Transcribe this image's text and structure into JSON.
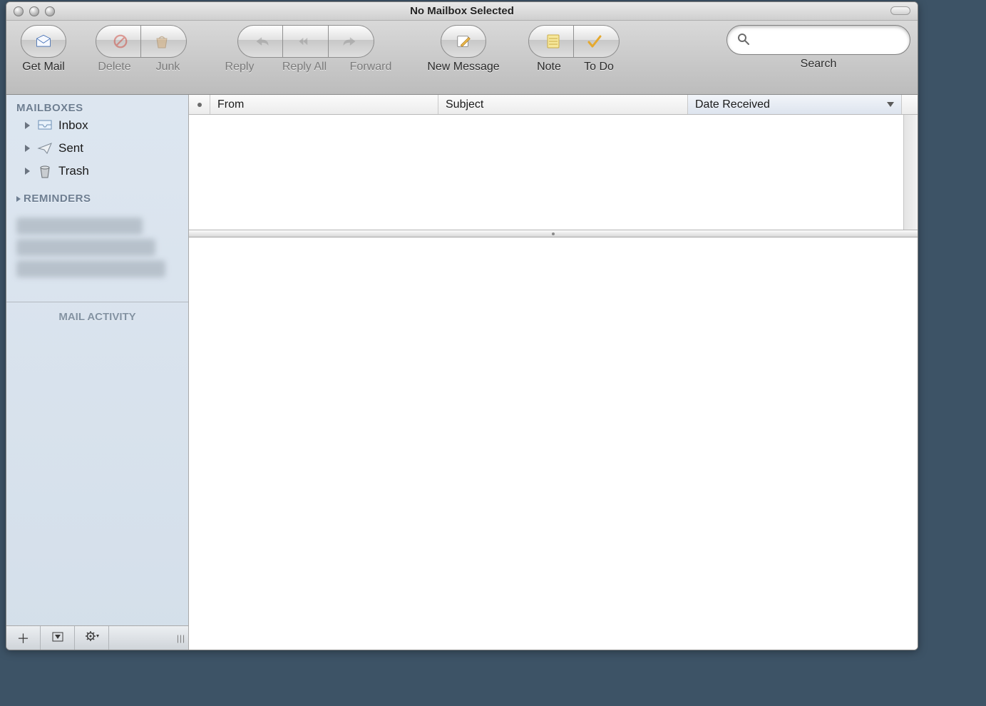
{
  "window": {
    "title": "No Mailbox Selected"
  },
  "toolbar": {
    "getmail": "Get Mail",
    "delete": "Delete",
    "junk": "Junk",
    "reply": "Reply",
    "replyall": "Reply All",
    "forward": "Forward",
    "newmessage": "New Message",
    "note": "Note",
    "todo": "To Do",
    "search_label": "Search",
    "search_placeholder": ""
  },
  "sidebar": {
    "sections": {
      "mailboxes": "MAILBOXES",
      "reminders": "REMINDERS",
      "activity": "MAIL ACTIVITY"
    },
    "items": {
      "inbox": "Inbox",
      "sent": "Sent",
      "trash": "Trash"
    }
  },
  "columns": {
    "from": "From",
    "subject": "Subject",
    "date": "Date Received"
  }
}
